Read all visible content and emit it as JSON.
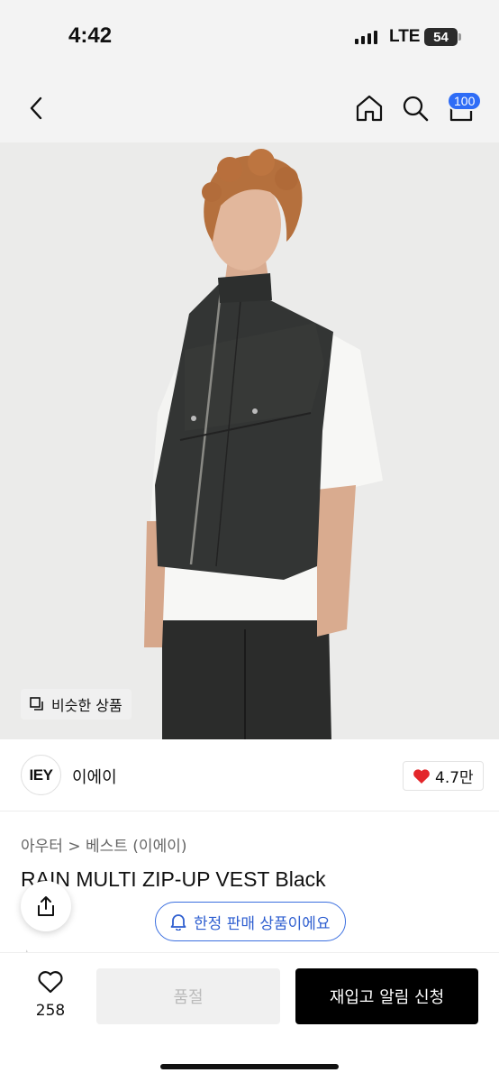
{
  "status": {
    "time": "4:42",
    "network": "LTE",
    "battery": "54"
  },
  "nav": {
    "cart_count": "100"
  },
  "hero": {
    "similar_label": "비슷한 상품"
  },
  "brand": {
    "logo_text": "IEY",
    "name": "이에이",
    "likes": "4.7만"
  },
  "product": {
    "breadcrumb": "아우터 > 베스트 (이에이)",
    "title": "RAIN MULTI ZIP-UP VEST Black"
  },
  "notice": {
    "limited_label": "한정 판매 상품이에요"
  },
  "bottom": {
    "wish_count": "258",
    "soldout_label": "품절",
    "restock_label": "재입고 알림 신청"
  },
  "colors": {
    "accent": "#2e6cf6",
    "heart": "#e3262a",
    "primary_button": "#000000"
  }
}
